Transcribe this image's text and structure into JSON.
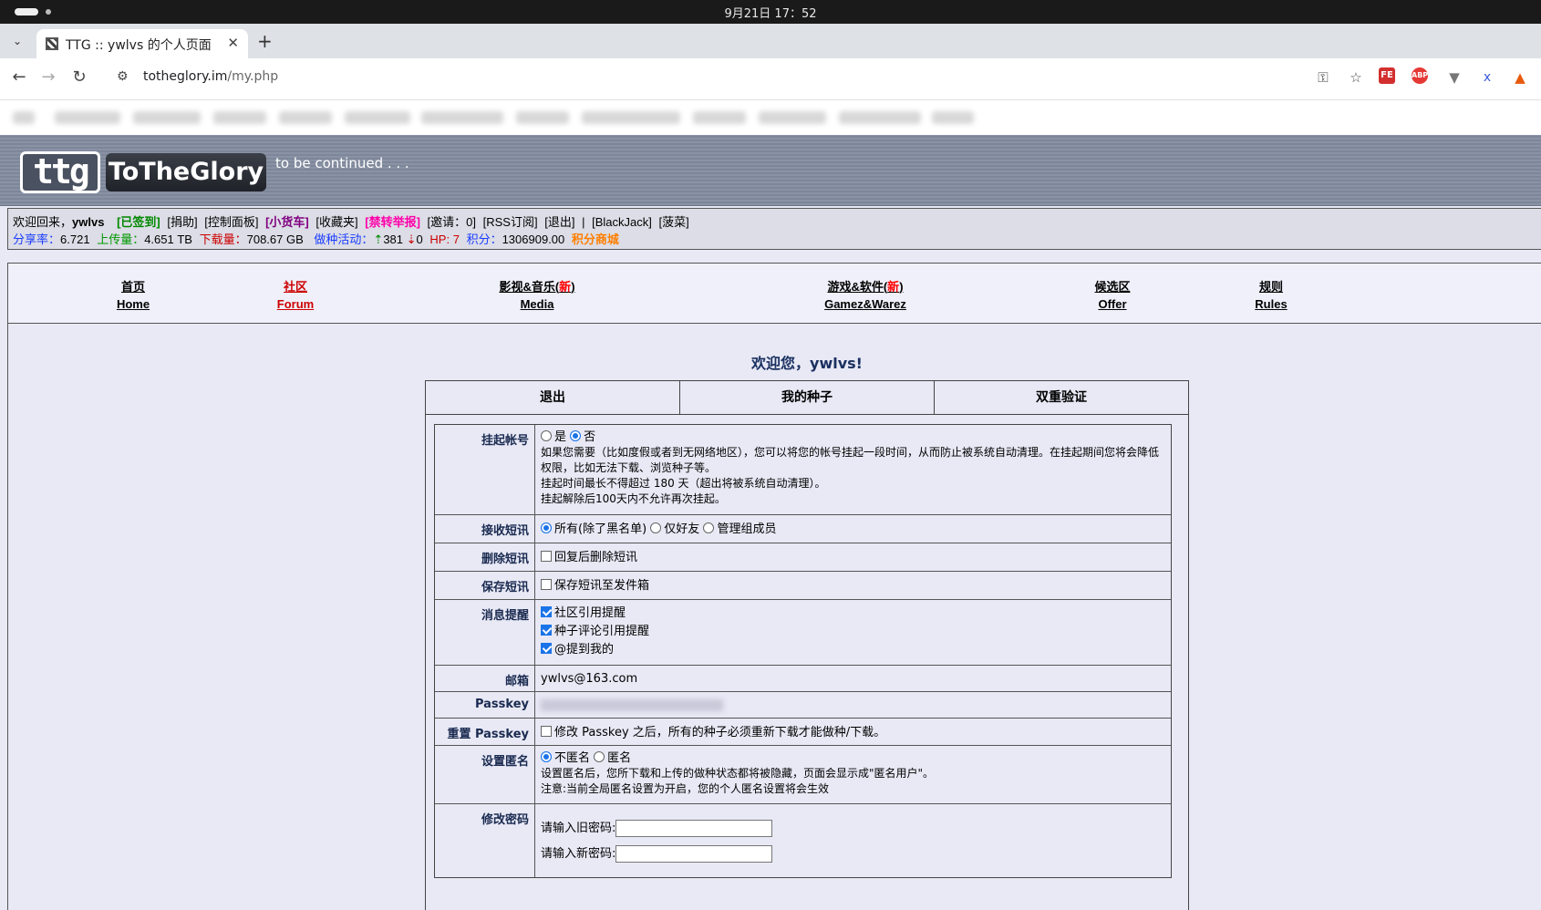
{
  "os": {
    "clock": "9月21日 17：52"
  },
  "browser": {
    "tab_title": "TTG :: ywlvs 的个人页面",
    "url_host": "totheglory.im",
    "url_path": "/my.php"
  },
  "site": {
    "logo_mark": "ttg",
    "logo_name": "ToTheGlory",
    "tagline": "to be continued . . ."
  },
  "infobar": {
    "welcome": "欢迎回来，",
    "username": "ywlvs",
    "links": [
      "[已签到]",
      "[捐助]",
      "[控制面板]",
      "[小货车]",
      "[收藏夹]",
      "[禁转举报]",
      "[邀请：0]",
      "[RSS订阅]",
      "[退出]",
      "|",
      "[BlackJack]",
      "[菠菜]"
    ],
    "ratio_label": "分享率：",
    "ratio": "6.721",
    "upload_label": "上传量：",
    "upload": "4.651 TB",
    "download_label": "下载量：",
    "download": "708.67 GB",
    "seeding_label": "做种活动：",
    "seeding_up": "381",
    "seeding_down": "0",
    "hp_label": "HP:",
    "hp": "7",
    "points_label": "积分：",
    "points": "1306909.00",
    "shop": "积分商城"
  },
  "mainnav": [
    {
      "cn": "首页",
      "en": "Home"
    },
    {
      "cn": "社区",
      "en": "Forum"
    },
    {
      "cn": "影视&音乐(",
      "new": "新",
      "close": ")",
      "en": "Media"
    },
    {
      "cn": "游戏&软件(",
      "new": "新",
      "close": ")",
      "en": "Gamez&Warez"
    },
    {
      "cn": "候选区",
      "en": "Offer"
    },
    {
      "cn": "规则",
      "en": "Rules"
    }
  ],
  "page": {
    "welcome": "欢迎您，ywlvs!",
    "tabs": [
      "退出",
      "我的种子",
      "双重验证"
    ]
  },
  "form": {
    "suspend": {
      "label": "挂起帐号",
      "yes": "是",
      "no": "否",
      "desc1": "如果您需要（比如度假或者到无网络地区），您可以将您的帐号挂起一段时间，从而防止被系统自动清理。在挂起期间您将会降低权限，比如无法下载、浏览种子等。",
      "desc2": "挂起时间最长不得超过 180 天（超出将被系统自动清理）。",
      "desc3": "挂起解除后100天内不允许再次挂起。"
    },
    "receive_pm": {
      "label": "接收短讯",
      "opt1": "所有(除了黑名单)",
      "opt2": "仅好友",
      "opt3": "管理组成员"
    },
    "delete_pm": {
      "label": "删除短讯",
      "text": "回复后删除短讯"
    },
    "save_pm": {
      "label": "保存短讯",
      "text": "保存短讯至发件箱"
    },
    "notify": {
      "label": "消息提醒",
      "opt1": "社区引用提醒",
      "opt2": "种子评论引用提醒",
      "opt3": "@提到我的"
    },
    "email": {
      "label": "邮箱",
      "value": "ywlvs@163.com"
    },
    "passkey": {
      "label": "Passkey"
    },
    "reset_passkey": {
      "label": "重置 Passkey",
      "text": "修改 Passkey 之后，所有的种子必须重新下载才能做种/下载。"
    },
    "anonymous": {
      "label": "设置匿名",
      "opt1": "不匿名",
      "opt2": "匿名",
      "desc1": "设置匿名后，您所下载和上传的做种状态都将被隐藏，页面会显示成\"匿名用户\"。",
      "desc2": "注意:当前全局匿名设置为开启，您的个人匿名设置将会生效"
    },
    "password": {
      "label": "修改密码",
      "old": "请输入旧密码:",
      "new": "请输入新密码:"
    }
  }
}
